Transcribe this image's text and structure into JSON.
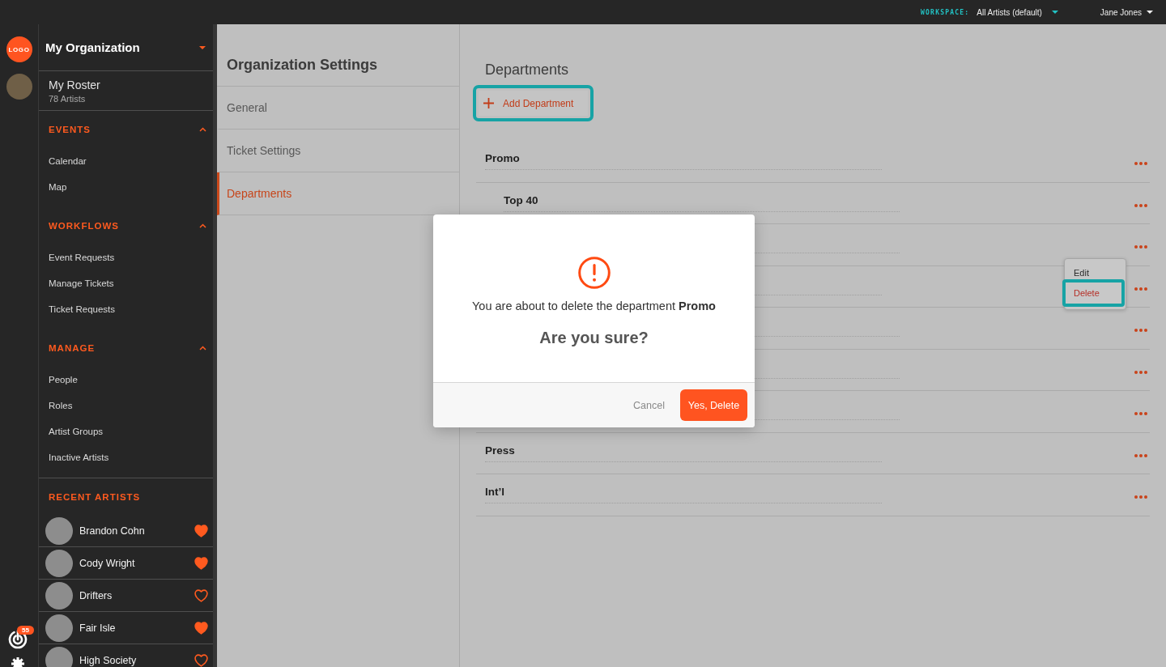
{
  "top_bar": {
    "workspace_label": "WORKSPACE:",
    "workspace": "All Artists (default)",
    "user": "Jane Jones"
  },
  "rail": {
    "logo": "LOGO",
    "notification_count": "55"
  },
  "sidebar": {
    "organization": "My Organization",
    "roster": {
      "title": "My Roster",
      "count": "78 Artists"
    },
    "sections": [
      {
        "title": "EVENTS",
        "expanded": true,
        "items": [
          "Calendar",
          "Map"
        ]
      },
      {
        "title": "WORKFLOWS",
        "expanded": true,
        "items": [
          "Event Requests",
          "Manage Tickets",
          "Ticket Requests"
        ]
      },
      {
        "title": "MANAGE",
        "expanded": true,
        "items": [
          "People",
          "Roles",
          "Artist Groups",
          "Inactive Artists"
        ]
      }
    ],
    "recent_artists": {
      "title": "RECENT ARTISTS",
      "artists": [
        {
          "name": "Brandon Cohn",
          "favorite": true
        },
        {
          "name": "Cody Wright",
          "favorite": true
        },
        {
          "name": "Drifters",
          "favorite": false
        },
        {
          "name": "Fair Isle",
          "favorite": true
        },
        {
          "name": "High Society",
          "favorite": false
        }
      ]
    }
  },
  "settings_nav": {
    "title": "Organization Settings",
    "items": [
      {
        "label": "General",
        "selected": false
      },
      {
        "label": "Ticket Settings",
        "selected": false
      },
      {
        "label": "Departments",
        "selected": true
      }
    ]
  },
  "departments": {
    "title": "Departments",
    "add_button": {
      "label": "Add Department",
      "highlighted": true
    },
    "rows": [
      {
        "name": "Promo",
        "menu_open": false,
        "children": [
          {
            "name": "Top 40",
            "menu_open": false
          },
          {
            "menu_open": false
          }
        ]
      },
      {
        "menu_open": true,
        "children": [
          {
            "menu_open": false
          },
          {
            "menu_open": false
          },
          {
            "menu_open": false
          }
        ]
      },
      {
        "name": "Press",
        "menu_open": false
      },
      {
        "name": "Int’l",
        "menu_open": false
      }
    ],
    "row_menu": {
      "items": [
        {
          "label": "Edit",
          "kind": "normal",
          "highlighted": false
        },
        {
          "label": "Delete",
          "kind": "destructive",
          "highlighted": true
        }
      ]
    }
  },
  "dialog": {
    "message": "You are about to delete the department **Promo**",
    "question": "Are you sure?",
    "cancel": "Cancel",
    "confirm": "Yes, Delete"
  }
}
